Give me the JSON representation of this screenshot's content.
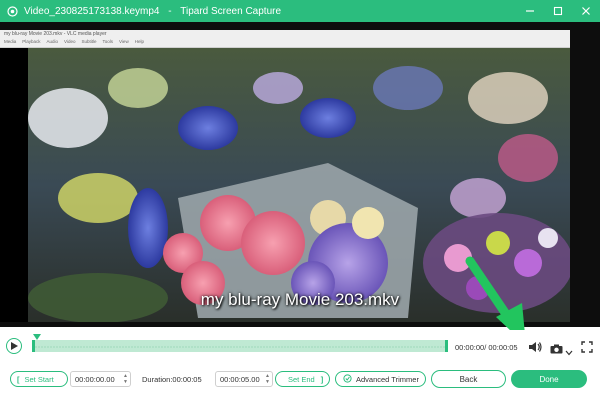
{
  "window": {
    "file_title": "Video_230825173138.keymp4",
    "separator": "-",
    "app_name": "Tipard Screen Capture"
  },
  "player": {
    "title": "my blu-ray Movie 203.mkv - VLC media player",
    "menu": [
      "Media",
      "Playback",
      "Audio",
      "Video",
      "Subtitle",
      "Tools",
      "View",
      "Help"
    ],
    "subtitle": "my blu-ray Movie 203.mkv"
  },
  "timeline": {
    "time_readout": "00:00:00/ 00:00:05",
    "progress": 0.0
  },
  "trim": {
    "set_start_label": "Set Start",
    "start_value": "00:00:00.00",
    "duration_label": "Duration:00:00:05",
    "end_value": "00:00:05.00",
    "set_end_label": "Set End",
    "advanced_trimmer_label": "Advanced Trimmer"
  },
  "actions": {
    "back_label": "Back",
    "done_label": "Done"
  },
  "colors": {
    "accent": "#2bbd7e",
    "annotation_arrow": "#22c55e"
  },
  "icons": [
    "app-logo-icon",
    "minimize-icon",
    "maximize-icon",
    "close-icon",
    "play-icon",
    "volume-icon",
    "camera-icon",
    "chevron-down-icon",
    "fullscreen-icon",
    "bracket-left-icon",
    "bracket-right-icon",
    "advanced-trimmer-icon"
  ]
}
